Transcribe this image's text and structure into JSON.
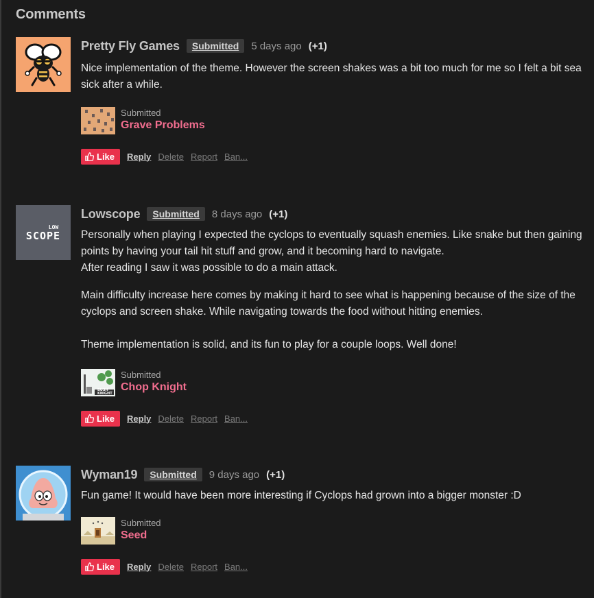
{
  "heading": "Comments",
  "comments": [
    {
      "author": "Pretty Fly Games",
      "badge": "Submitted",
      "time": "5 days ago",
      "votes": "(+1)",
      "paragraphs": [
        "Nice implementation of the theme. However the screen shakes was a bit too much for me so I felt a bit sea sick after a while."
      ],
      "submitted_label": "Submitted",
      "game_title": "Grave Problems",
      "avatar_icon": "fly-mascot-icon"
    },
    {
      "author": "Lowscope",
      "badge": "Submitted",
      "time": "8 days ago",
      "votes": "(+1)",
      "avatar_logo_top": "LOW",
      "avatar_logo_bottom": "SCOPE",
      "paragraphs": [
        "Personally when playing I expected the cyclops to eventually squash enemies. Like snake but then gaining points by having your tail hit stuff and grow, and it becoming hard to navigate.\nAfter reading I saw it was possible to do a main attack.",
        "Main difficulty increase here comes by making it hard to see what is happening because of the size of the cyclops and screen shake. While navigating towards the food without hitting enemies.",
        "Theme implementation is solid, and its fun to play for a couple loops. Well done!"
      ],
      "submitted_label": "Submitted",
      "game_title": "Chop Knight",
      "thumb_text_1": "BUSH",
      "thumb_text_2": "KNIGHT"
    },
    {
      "author": "Wyman19",
      "badge": "Submitted",
      "time": "9 days ago",
      "votes": "(+1)",
      "paragraphs": [
        "Fun game! It would have been more interesting if Cyclops had grown into a bigger monster :D"
      ],
      "submitted_label": "Submitted",
      "game_title": "Seed",
      "avatar_icon": "starfish-astronaut-icon"
    }
  ],
  "actions": {
    "like": "Like",
    "reply": "Reply",
    "delete": "Delete",
    "report": "Report",
    "ban": "Ban..."
  },
  "colors": {
    "background": "#1b1b1b",
    "like_button": "#e9324c",
    "game_link": "#f26e8f",
    "badge_bg": "#3a3a3a"
  }
}
